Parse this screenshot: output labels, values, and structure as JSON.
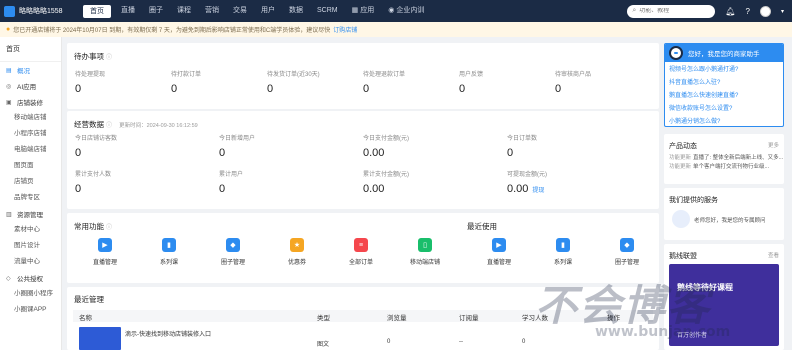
{
  "brand": {
    "name": "略略略略1558"
  },
  "nav": [
    {
      "label": "首页",
      "active": true,
      "icon": ""
    },
    {
      "label": "直播",
      "active": false,
      "icon": ""
    },
    {
      "label": "圈子",
      "active": false,
      "icon": ""
    },
    {
      "label": "课程",
      "active": false,
      "icon": ""
    },
    {
      "label": "营销",
      "active": false,
      "icon": ""
    },
    {
      "label": "交易",
      "active": false,
      "icon": ""
    },
    {
      "label": "用户",
      "active": false,
      "icon": ""
    },
    {
      "label": "数据",
      "active": false,
      "icon": ""
    },
    {
      "label": "SCRM",
      "active": false,
      "icon": ""
    },
    {
      "label": "应用",
      "active": false,
      "icon": "grid-icon"
    },
    {
      "label": "企业内训",
      "active": false,
      "icon": "user-icon"
    }
  ],
  "search": {
    "placeholder": "功能、教程"
  },
  "notice": {
    "text": "您已开通店铺将于 2024年10月07日 到期，有效期仅剩 7 天，为避免到期后影响店铺正常使用和C端学员体验，建议尽快",
    "link": "订购店铺"
  },
  "sidebar": {
    "home": "首页",
    "groups": [
      {
        "label": "概况",
        "icon": "chart-icon",
        "active": true,
        "subs": []
      },
      {
        "label": "AI应用",
        "icon": "robot-icon",
        "active": false,
        "subs": []
      },
      {
        "label": "店铺装修",
        "icon": "store-icon",
        "active": false,
        "subs": [
          "移动端店铺",
          "小程序店铺",
          "电脑端店铺",
          "图页面",
          "店铺页",
          "品牌专区"
        ]
      },
      {
        "label": "资源管理",
        "icon": "folder-icon",
        "active": false,
        "subs": [
          "素材中心",
          "图片设计",
          "流量中心"
        ]
      },
      {
        "label": "公共授权",
        "icon": "key-icon",
        "active": false,
        "subs": [
          "小圈圈小程序",
          "小圈课APP"
        ]
      }
    ]
  },
  "todo": {
    "title": "待办事项",
    "items": [
      {
        "label": "待处理提现",
        "value": "0"
      },
      {
        "label": "待打款订单",
        "value": "0"
      },
      {
        "label": "待发货订单(近30天)",
        "value": "0"
      },
      {
        "label": "待处理退款订单",
        "value": "0"
      },
      {
        "label": "用户反馈",
        "value": "0"
      },
      {
        "label": "待审核商户品",
        "value": "0"
      }
    ]
  },
  "business": {
    "title": "经营数据",
    "updated": "更新时间：2024-09-30 16:12:59",
    "row1": [
      {
        "label": "今日店铺访客数",
        "value": "0"
      },
      {
        "label": "今日新增用户",
        "value": "0"
      },
      {
        "label": "今日支付金额(元)",
        "value": "0.00"
      },
      {
        "label": "今日订单数",
        "value": "0"
      }
    ],
    "row2": [
      {
        "label": "累计支付人数",
        "value": "0"
      },
      {
        "label": "累计用户",
        "value": "0"
      },
      {
        "label": "累计支付金额(元)",
        "value": "0.00"
      },
      {
        "label": "可提现金额(元)",
        "value": "0.00",
        "link": "提现"
      }
    ]
  },
  "common": {
    "title": "常用功能",
    "recent_title": "最近使用",
    "tools": [
      {
        "label": "直播管理",
        "icon": "live-icon",
        "color": "#2d8cf0"
      },
      {
        "label": "系列课",
        "icon": "book-icon",
        "color": "#2d8cf0"
      },
      {
        "label": "圈子管理",
        "icon": "group-icon",
        "color": "#2d8cf0"
      },
      {
        "label": "优惠券",
        "icon": "coupon-icon",
        "color": "#f5a623"
      },
      {
        "label": "全部订单",
        "icon": "order-icon",
        "color": "#f5474d"
      },
      {
        "label": "移动端店铺",
        "icon": "phone-icon",
        "color": "#19be6b"
      }
    ],
    "recent": [
      {
        "label": "直播管理",
        "icon": "live-icon",
        "color": "#2d8cf0"
      },
      {
        "label": "系列课",
        "icon": "book-icon",
        "color": "#2d8cf0"
      },
      {
        "label": "圈子管理",
        "icon": "group-icon",
        "color": "#2d8cf0"
      }
    ]
  },
  "recent_manage": {
    "title": "最近管理",
    "columns": [
      "名称",
      "类型",
      "浏览量",
      "订阅量",
      "学习人数",
      "操作"
    ],
    "rows": [
      {
        "name": "滴示-快速找到移动店铺装修入口",
        "type": "图文",
        "views": "0",
        "subs": "--",
        "learners": "0"
      }
    ]
  },
  "assistant": {
    "title": "您好，我是您的商家助手",
    "faqs": [
      "视频号怎么跟小鹅通打通?",
      "抖音直播怎么入驻?",
      "鹅直播怎么快速创建直播?",
      "微信收款账号怎么设置?",
      "小鹅通分销怎么做?"
    ]
  },
  "product": {
    "title": "产品动态",
    "more": "更多",
    "items": [
      {
        "tag": "功能更新",
        "text": "直播了: 整体全新后端新上线、又多..."
      },
      {
        "tag": "功能更新",
        "text": "单个客户端打交流刊物行业级..."
      }
    ]
  },
  "services": {
    "title": "我们提供的服务",
    "text": "老师您好，我是您的专属顾问"
  },
  "school": {
    "title": "鹅线联盟",
    "more": "查看",
    "banner": "鹅线等待好课程",
    "sub": "百万创作者"
  },
  "watermark": {
    "main": "不会博客",
    "sub": "www.bunjan.com"
  }
}
